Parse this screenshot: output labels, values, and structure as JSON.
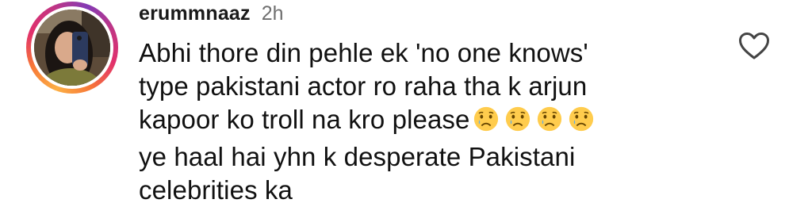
{
  "comment": {
    "username": "erummnaaz",
    "timestamp": "2h",
    "lines": [
      "Abhi thore din pehle ek 'no one knows'",
      "type pakistani actor ro raha tha k arjun",
      "kapoor ko troll na kro please",
      "ye haal hai yhn k desperate Pakistani",
      "celebrities ka"
    ],
    "emoji": [
      "crying-face",
      "crying-face",
      "crying-face",
      "crying-face"
    ]
  },
  "icons": {
    "like": "heart-outline-icon",
    "avatar_ring_colors": [
      "#fcaf45",
      "#f77737",
      "#e1306c",
      "#c13584",
      "#833ab4"
    ]
  }
}
